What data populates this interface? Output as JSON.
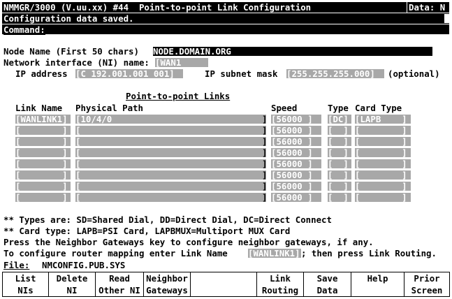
{
  "header": {
    "title": "NMMGR/3000 (V.uu.xx) #44  Point-to-point Link Configuration",
    "data_flag": "Data: N"
  },
  "status_message": "Configuration data saved.",
  "command_label": "Command:",
  "node": {
    "label": "Node Name (First 50 chars)",
    "value": "NODE.DOMAIN.ORG"
  },
  "ni": {
    "label": "Network interface (NI) name:",
    "value": "[WAN1      ]"
  },
  "ip": {
    "address_label": "IP address",
    "address_value": "[C 192.001.001 001]",
    "mask_label": "IP subnet mask",
    "mask_value": "[255.255.255.000]",
    "optional_label": "(optional)"
  },
  "links": {
    "section_title": "Point-to-point Links",
    "columns": {
      "link_name": "Link Name",
      "physical_path": "Physical Path",
      "speed": "Speed",
      "type": "Type",
      "card_type": "Card Type"
    },
    "rows": [
      {
        "name": "[WANLINK1]",
        "path": "[10/4/0",
        "speed": "[56000 ]",
        "type": "[DC]",
        "card": "[LAPB    ]"
      },
      {
        "name": "[        ]",
        "path": "[",
        "speed": "[56000 ]",
        "type": "[  ]",
        "card": "[        ]"
      },
      {
        "name": "[        ]",
        "path": "[",
        "speed": "[56000 ]",
        "type": "[  ]",
        "card": "[        ]"
      },
      {
        "name": "[        ]",
        "path": "[",
        "speed": "[56000 ]",
        "type": "[  ]",
        "card": "[        ]"
      },
      {
        "name": "[        ]",
        "path": "[",
        "speed": "[56000 ]",
        "type": "[  ]",
        "card": "[        ]"
      },
      {
        "name": "[        ]",
        "path": "[",
        "speed": "[56000 ]",
        "type": "[  ]",
        "card": "[        ]"
      },
      {
        "name": "[        ]",
        "path": "[",
        "speed": "[56000 ]",
        "type": "[  ]",
        "card": "[        ]"
      },
      {
        "name": "[        ]",
        "path": "[",
        "speed": "[56000 ]",
        "type": "[  ]",
        "card": "[        ]"
      }
    ],
    "path_close": "]"
  },
  "help": {
    "types": "** Types are: SD=Shared Dial, DD=Direct Dial, DC=Direct Connect",
    "cards": "** Card type: LAPB=PSI Card, LAPBMUX=Multiport MUX Card",
    "neighbor": "Press the Neighbor Gateways key to configure neighbor gateways, if any.",
    "router_pre": "To configure router mapping enter Link Name",
    "router_field": "[WANLINK1]",
    "router_post": "; then press Link Routing."
  },
  "file": {
    "label": "File:",
    "value": "NMCONFIG.PUB.SYS"
  },
  "function_keys": [
    {
      "line1": "List",
      "line2": "NIs"
    },
    {
      "line1": "Delete",
      "line2": "NI"
    },
    {
      "line1": "Read",
      "line2": "Other NI"
    },
    {
      "line1": "Neighbor",
      "line2": "Gateways"
    },
    {
      "line1": "",
      "line2": ""
    },
    {
      "line1": "Link",
      "line2": "Routing"
    },
    {
      "line1": "Save",
      "line2": "Data"
    },
    {
      "line1": "Help",
      "line2": ""
    },
    {
      "line1": "Prior",
      "line2": "Screen"
    }
  ]
}
